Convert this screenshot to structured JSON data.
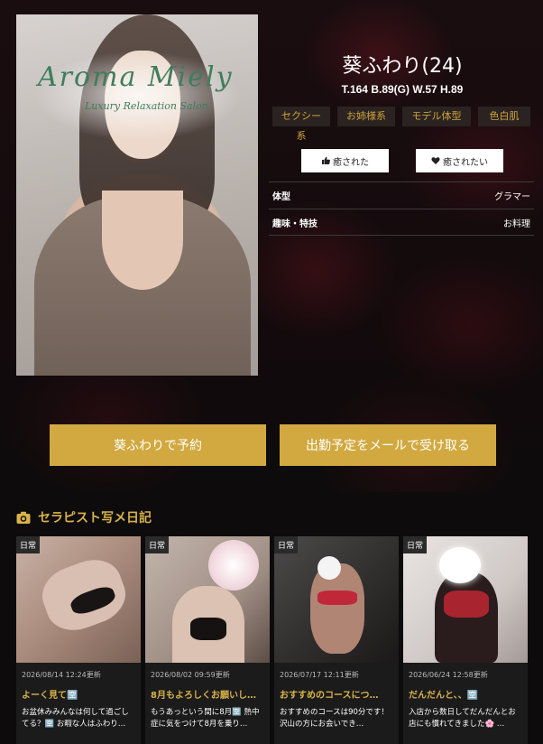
{
  "profile": {
    "logo_text": "Aroma Miely",
    "logo_sub": "Luxury Relaxation Salon",
    "name": "葵ふわり(24)",
    "measures": "T.164  B.89(G)  W.57  H.89",
    "tags": [
      "セクシー系",
      "お姉様系",
      "モデル体型",
      "色白肌"
    ],
    "like_buttons": [
      {
        "label": "癒された",
        "icon": "thumbs-up-icon"
      },
      {
        "label": "癒されたい",
        "icon": "heart-icon"
      }
    ],
    "info": [
      {
        "key": "体型",
        "value": "グラマー"
      },
      {
        "key": "趣味・特技",
        "value": "お料理"
      }
    ]
  },
  "actions": {
    "reserve_label": "葵ふわりで予約",
    "mail_label": "出勤予定をメールで受け取る"
  },
  "diary": {
    "title": "セラピスト写メ日記",
    "icon": "camera-icon",
    "accent_color": "#d8b24a",
    "cards": [
      {
        "category": "日常",
        "date": "2026/08/14 12:24更新",
        "title": "よーく見て🈳",
        "body": "お盆休みみんなは何して過ごしてる？🈳 お暇な人はふわり…"
      },
      {
        "category": "日常",
        "date": "2026/08/02 09:59更新",
        "title": "8月もよろしくお願いし…",
        "body": "もうあっという間に8月🈳 熱中症に気をつけて8月を乗り…"
      },
      {
        "category": "日常",
        "date": "2026/07/17 12:11更新",
        "title": "おすすめのコースにつ…",
        "body": "おすすめのコースは90分です！ 沢山の方にお会いでき…"
      },
      {
        "category": "日常",
        "date": "2026/06/24 12:58更新",
        "title": "だんだんと、、🈳",
        "body": "入店から数日してだんだんとお店にも慣れてきました🌸 …"
      }
    ]
  },
  "colors": {
    "gold_button": "#d1a940",
    "tag_text": "#cfa23a",
    "tag_bg": "#2a2322"
  }
}
